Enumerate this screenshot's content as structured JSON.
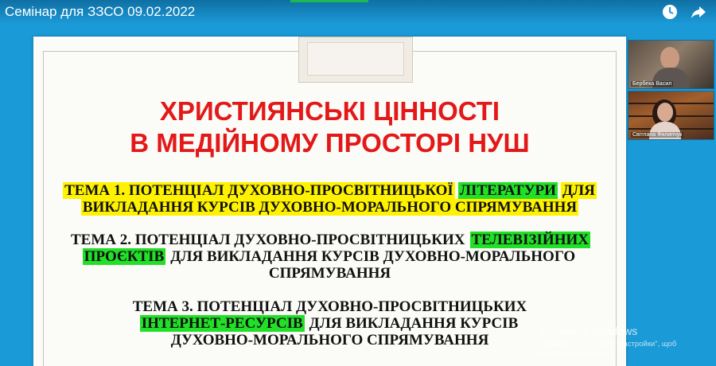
{
  "header": {
    "title": "Семінар для ЗЗСО 09.02.2022",
    "watch_later_icon": "clock-icon",
    "share_icon": "share-arrow-icon"
  },
  "slide": {
    "title_line1": "ХРИСТИЯНСЬКІ ЦІННОСТІ",
    "title_line2": "В МЕДІЙНОМУ ПРОСТОРІ НУШ",
    "topic1": {
      "part1": "ТЕМА 1. ПОТЕНЦІАЛ ДУХОВНО-ПРОСВІТНИЦЬКОЇ",
      "highlight": "ЛІТЕРАТУРИ",
      "part2": "ДЛЯ",
      "line2": "ВИКЛАДАННЯ КУРСІВ ДУХОВНО-МОРАЛЬНОГО СПРЯМУВАННЯ"
    },
    "topic2": {
      "part1": "ТЕМА 2. ПОТЕНЦІАЛ ДУХОВНО-ПРОСВІТНИЦЬКИХ",
      "highlight1": "ТЕЛЕВІЗІЙНИХ",
      "highlight2": "ПРОЄКТІВ",
      "part2": "ДЛЯ ВИКЛАДАННЯ КУРСІВ ДУХОВНО-МОРАЛЬНОГО",
      "line3": "СПРЯМУВАННЯ"
    },
    "topic3": {
      "line1": "ТЕМА 3. ПОТЕНЦІАЛ ДУХОВНО-ПРОСВІТНИЦЬКИХ",
      "highlight": "ІНТЕРНЕТ-РЕСУРСІВ",
      "part2": "ДЛЯ ВИКЛАДАННЯ КУРСІВ",
      "line3": "ДУХОВНО-МОРАЛЬНОГО СПРЯМУВАННЯ"
    }
  },
  "participants": [
    {
      "name": "Бербека Васил"
    },
    {
      "name": "Світлана Филипчук"
    }
  ],
  "watermark": {
    "title": "Активація Windows",
    "line1": "Перейдіть до розділу \"Настройки\", щоб",
    "line2": "активувати Windows."
  },
  "colors": {
    "background": "#1b9ad8",
    "title_red": "#e31818",
    "highlight_yellow": "#fff200",
    "highlight_green": "#22e028"
  }
}
